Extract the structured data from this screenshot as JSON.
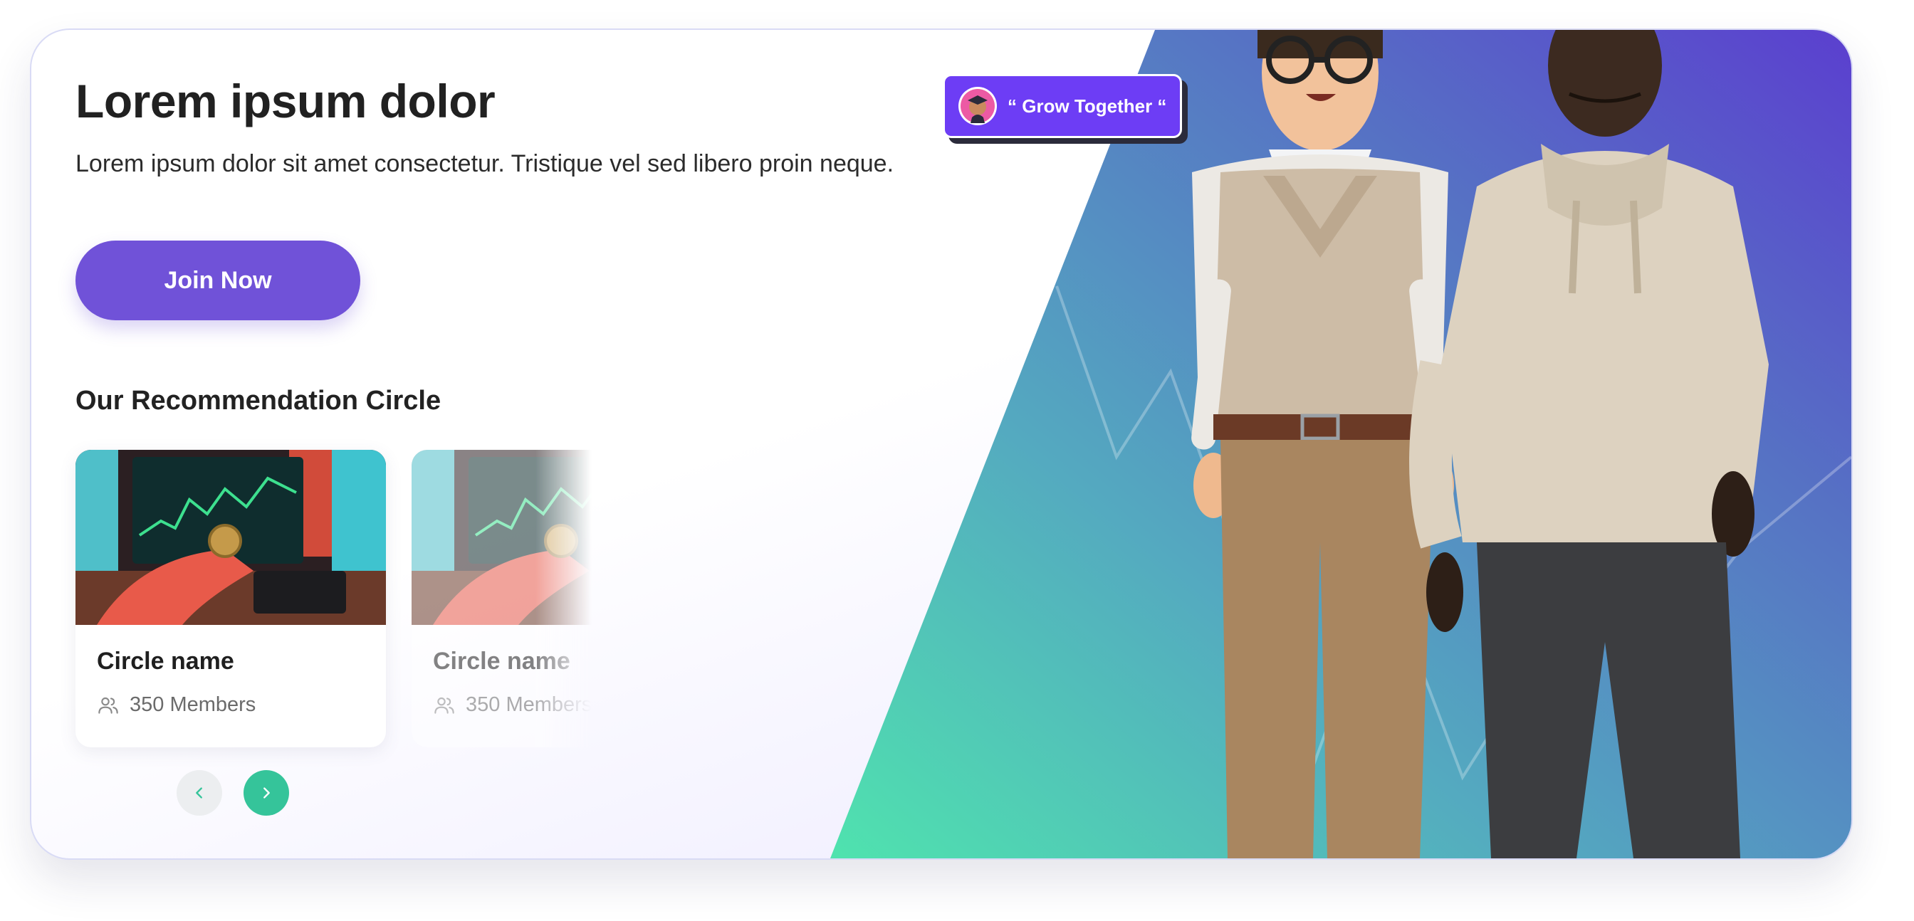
{
  "hero": {
    "title": "Lorem ipsum dolor",
    "subtitle": "Lorem ipsum dolor sit amet consectetur. Tristique vel sed libero proin neque.",
    "join_label": "Join Now",
    "badge_text": "“ Grow Together “"
  },
  "recommendations": {
    "title": "Our Recommendation Circle",
    "cards": [
      {
        "name": "Circle name",
        "members": "350 Members"
      },
      {
        "name": "Circle name",
        "members": "350 Members"
      }
    ]
  },
  "carousel": {
    "prev_icon": "chevron-left-icon",
    "next_icon": "chevron-right-icon"
  },
  "colors": {
    "accent_purple": "#7052d8",
    "badge_purple": "#6d3df5",
    "teal": "#35c49a",
    "gradient_start": "#52e0b0",
    "gradient_end": "#5a3fd0"
  }
}
